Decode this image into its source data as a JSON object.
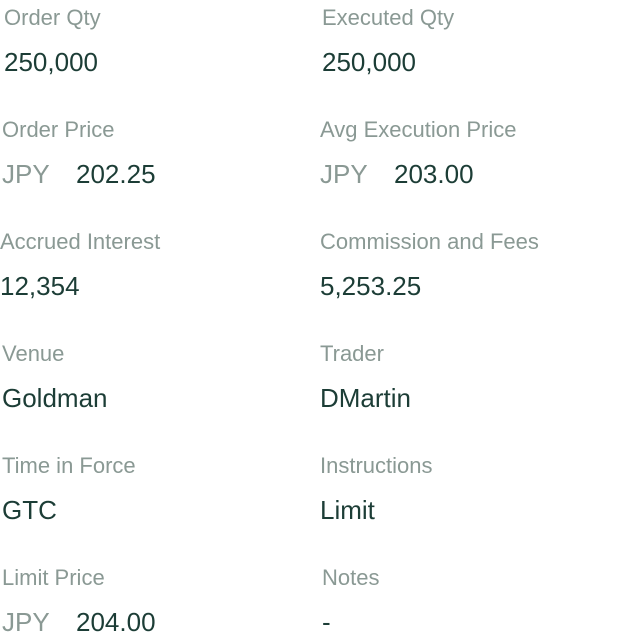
{
  "details": {
    "order_qty": {
      "label": "Order Qty",
      "value": "250,000"
    },
    "executed_qty": {
      "label": "Executed Qty",
      "value": "250,000"
    },
    "order_price": {
      "label": "Order Price",
      "currency": "JPY",
      "value": "202.25"
    },
    "avg_execution_price": {
      "label": "Avg Execution Price",
      "currency": "JPY",
      "value": "203.00"
    },
    "accrued_interest": {
      "label": "Accrued Interest",
      "value": "12,354"
    },
    "commission_fees": {
      "label": "Commission and Fees",
      "value": "5,253.25"
    },
    "venue": {
      "label": "Venue",
      "value": "Goldman"
    },
    "trader": {
      "label": "Trader",
      "value": "DMartin"
    },
    "time_in_force": {
      "label": "Time in Force",
      "value": "GTC"
    },
    "instructions": {
      "label": "Instructions",
      "value": "Limit"
    },
    "limit_price": {
      "label": "Limit Price",
      "currency": "JPY",
      "value": "204.00"
    },
    "notes": {
      "label": "Notes",
      "value": "-"
    }
  },
  "colors": {
    "label": "#8a9994",
    "value": "#1c3d36",
    "background": "#ffffff"
  }
}
